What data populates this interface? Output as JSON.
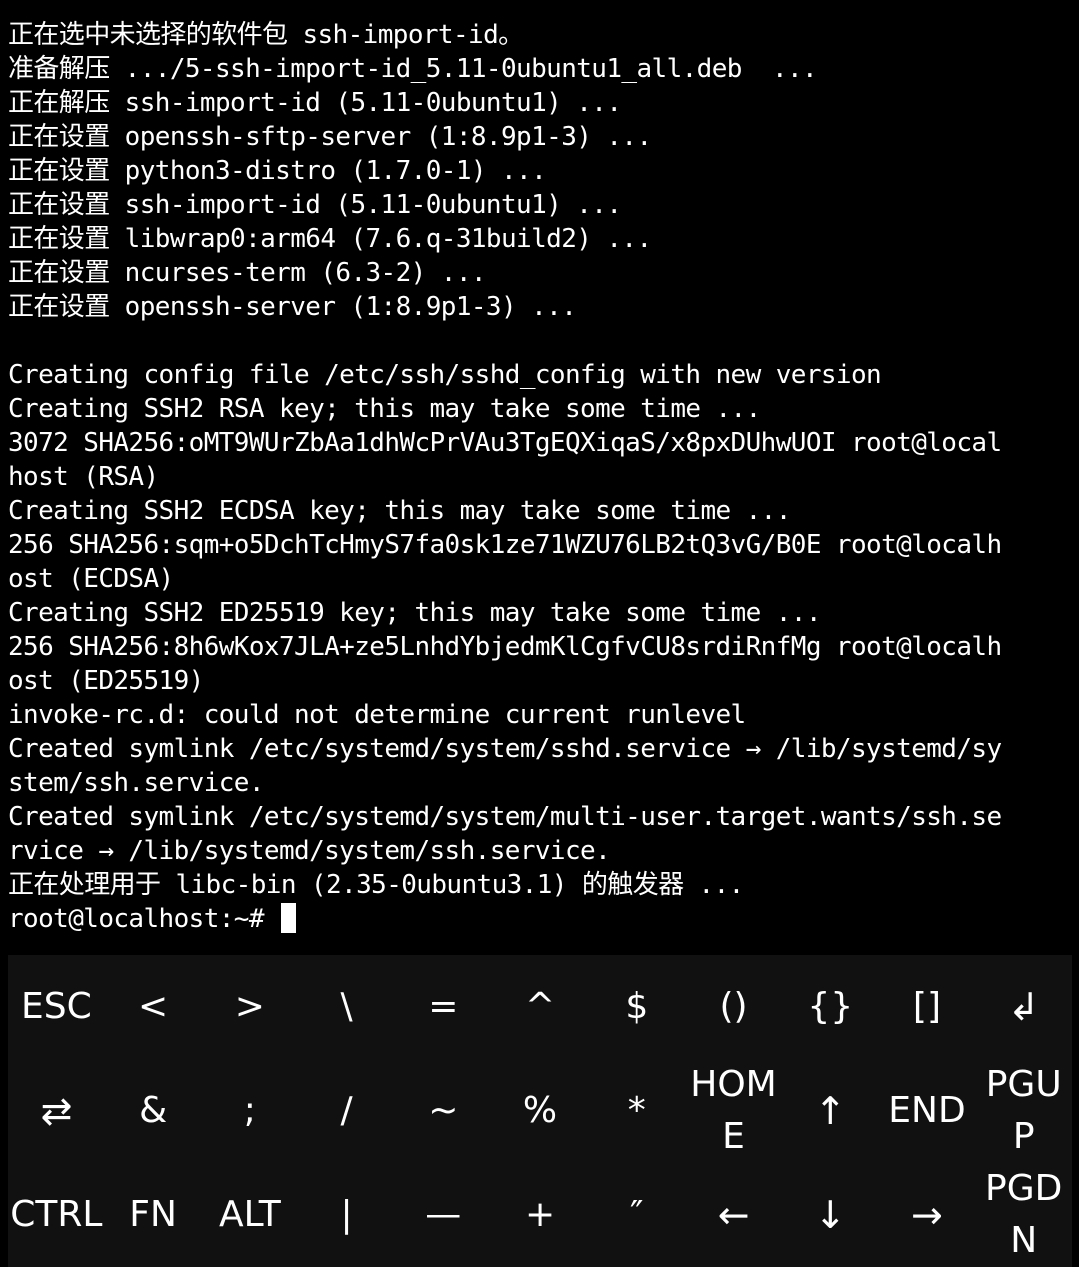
{
  "terminal": {
    "lines": [
      "正在选中未选择的软件包 ssh-import-id。",
      "准备解压 .../5-ssh-import-id_5.11-0ubuntu1_all.deb  ...",
      "正在解压 ssh-import-id (5.11-0ubuntu1) ...",
      "正在设置 openssh-sftp-server (1:8.9p1-3) ...",
      "正在设置 python3-distro (1.7.0-1) ...",
      "正在设置 ssh-import-id (5.11-0ubuntu1) ...",
      "正在设置 libwrap0:arm64 (7.6.q-31build2) ...",
      "正在设置 ncurses-term (6.3-2) ...",
      "正在设置 openssh-server (1:8.9p1-3) ...",
      "",
      "Creating config file /etc/ssh/sshd_config with new version",
      "Creating SSH2 RSA key; this may take some time ...",
      "3072 SHA256:oMT9WUrZbAa1dhWcPrVAu3TgEQXiqaS/x8pxDUhwUOI root@local",
      "host (RSA)",
      "Creating SSH2 ECDSA key; this may take some time ...",
      "256 SHA256:sqm+o5DchTcHmyS7fa0sk1ze71WZU76LB2tQ3vG/B0E root@localh",
      "ost (ECDSA)",
      "Creating SSH2 ED25519 key; this may take some time ...",
      "256 SHA256:8h6wKox7JLA+ze5LnhdYbjedmKlCgfvCU8srdiRnfMg root@localh",
      "ost (ED25519)",
      "invoke-rc.d: could not determine current runlevel",
      "Created symlink /etc/systemd/system/sshd.service → /lib/systemd/sy",
      "stem/ssh.service.",
      "Created symlink /etc/systemd/system/multi-user.target.wants/ssh.se",
      "rvice → /lib/systemd/system/ssh.service.",
      "正在处理用于 libc-bin (2.35-0ubuntu3.1) 的触发器 ..."
    ],
    "prompt": "root@localhost:~# "
  },
  "extra_keys": {
    "row1": [
      "ESC",
      "<",
      ">",
      "\\",
      "=",
      "^",
      "$",
      "()",
      "{}",
      "[]",
      "↲"
    ],
    "row2": [
      "⇄",
      "&",
      ";",
      "/",
      "~",
      "%",
      "*",
      "HOME",
      "↑",
      "END",
      "PGUP"
    ],
    "row3": [
      "CTRL",
      "FN",
      "ALT",
      "|",
      "—",
      "+",
      "″",
      "←",
      "↓",
      "→",
      "PGDN"
    ]
  },
  "colors": {
    "terminal_background": "#000000",
    "terminal_foreground": "#ffffff",
    "keyboard_background": "#111111"
  }
}
